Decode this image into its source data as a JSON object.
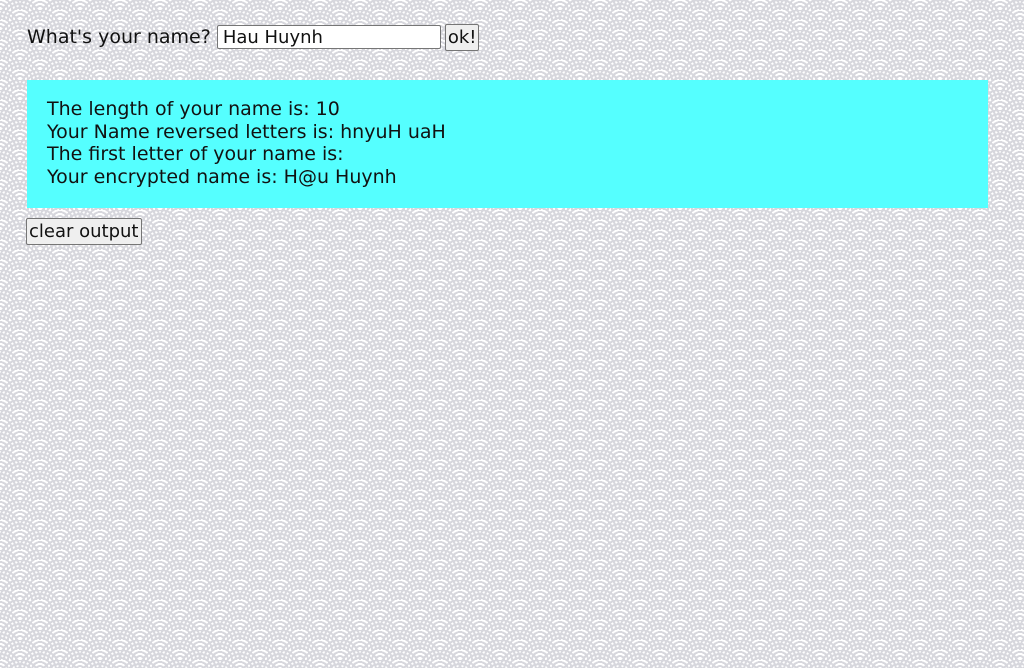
{
  "form": {
    "label": "What's your name?",
    "input_value": "Hau Huynh",
    "submit_label": "ok!"
  },
  "output": {
    "lines": [
      "The length of your name is: 10",
      "Your Name reversed letters is: hnyuH uaH",
      "The first letter of your name is:",
      "Your encrypted name is: H@u Huynh"
    ],
    "background_color": "#55ffff"
  },
  "actions": {
    "clear_label": "clear output"
  },
  "background": {
    "pattern": "seigaiha-waves",
    "color": "#d7d7dd"
  }
}
